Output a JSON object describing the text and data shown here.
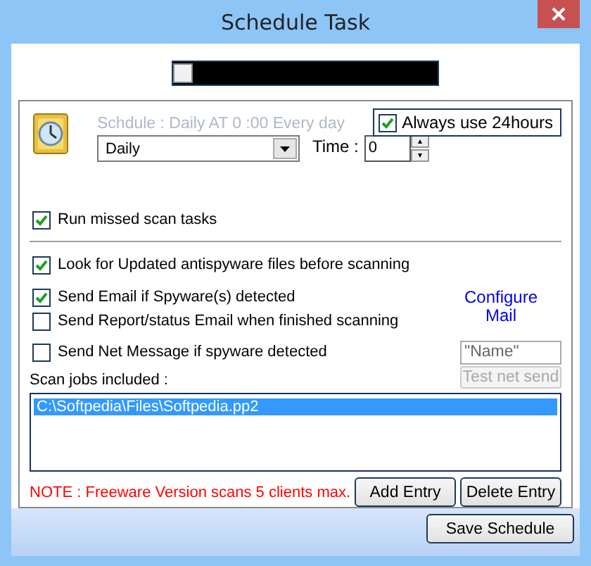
{
  "window": {
    "title": "Schedule Task"
  },
  "progress": {
    "level": 0
  },
  "schedule": {
    "summary": "Schdule : Daily AT 0 :00  Every day",
    "always_24h": {
      "label": "Always use 24hours",
      "checked": true
    },
    "frequency": "Daily",
    "time_label": "Time :",
    "time": "0"
  },
  "run_missed": {
    "label": "Run missed scan tasks",
    "checked": true
  },
  "options": [
    {
      "label": "Look for Updated antispyware files before scanning",
      "checked": true
    },
    {
      "label": "Send Email if Spyware(s) detected",
      "checked": true
    },
    {
      "label": "Send Report/status Email when finished scanning",
      "checked": false
    },
    {
      "label": "Send Net Message if spyware detected",
      "checked": false
    }
  ],
  "configure_mail": "Configure Mail",
  "net_name": "\"Name\"",
  "test_button": {
    "label": "Test net send",
    "disabled": true
  },
  "scan_jobs": {
    "label": "Scan jobs included :",
    "items": [
      {
        "path": "C:\\Softpedia\\Files\\Softpedia.pp2",
        "selected": true
      }
    ]
  },
  "note": "NOTE : Freeware Version scans 5 clients max.",
  "entry_buttons": [
    "Add Entry",
    "Delete Entry"
  ],
  "save_button": "Save Schedule"
}
